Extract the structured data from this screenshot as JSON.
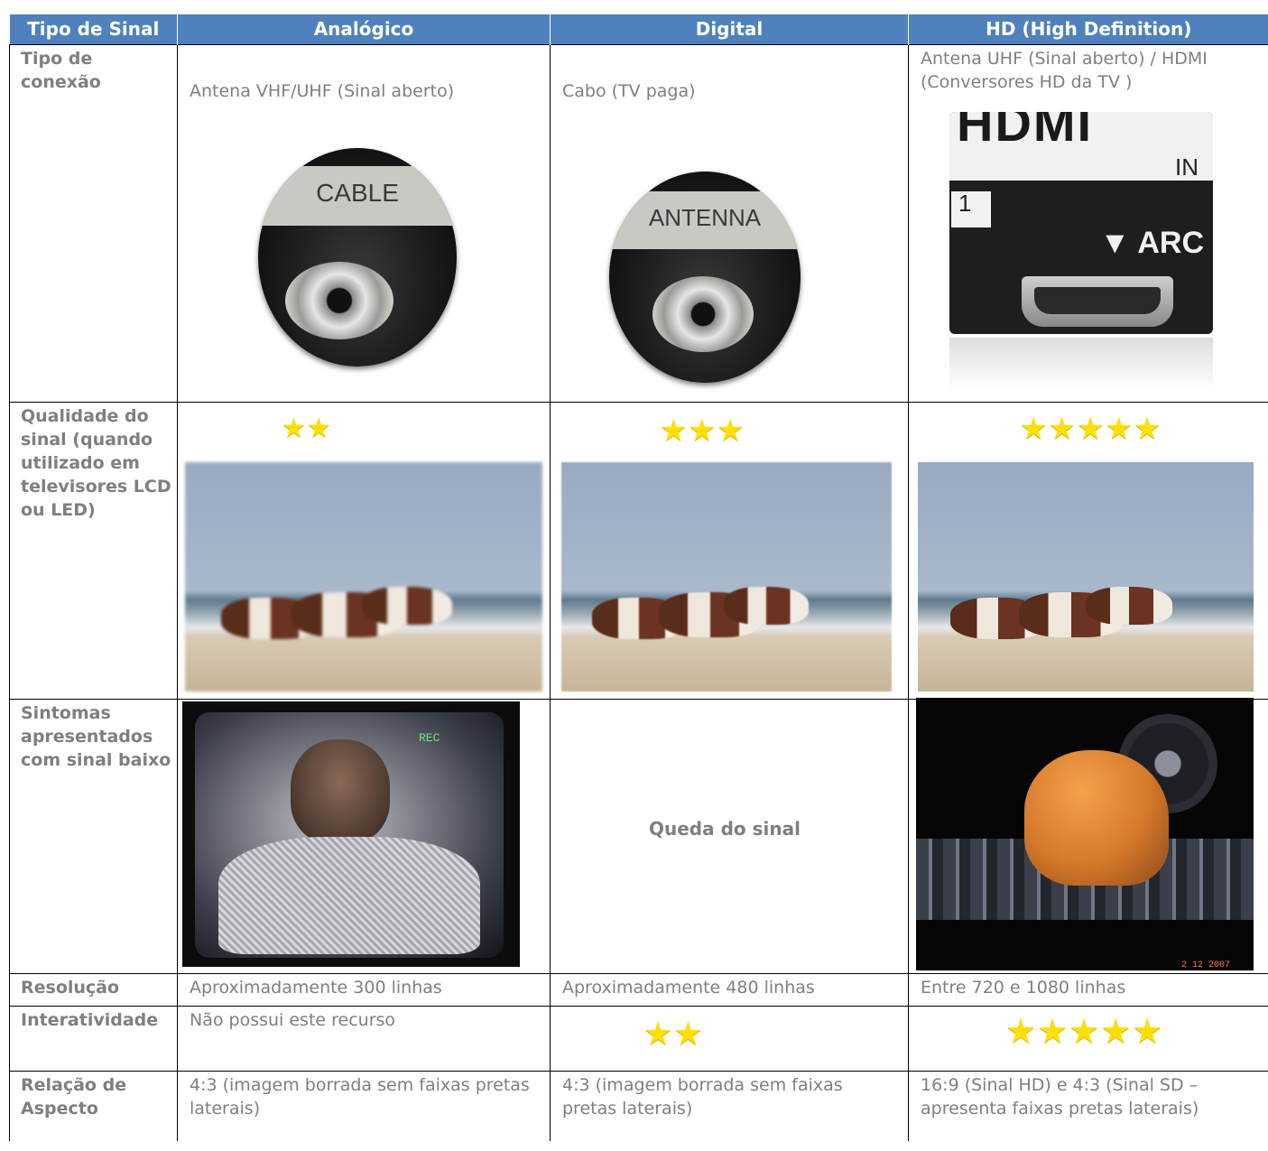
{
  "header": {
    "col0": "Tipo de Sinal",
    "col1": "Analógico",
    "col2": "Digital",
    "col3": "HD (High Definition)"
  },
  "rows": {
    "conexao": {
      "label": "Tipo de conexão",
      "analogico": "Antena VHF/UHF (Sinal aberto)",
      "digital": "Cabo (TV paga)",
      "hd": "Antena UHF (Sinal aberto) / HDMI (Conversores HD da TV )",
      "img_analogico_text": "CABLE",
      "img_digital_text": "ANTENNA",
      "img_hd_word": "HDMI",
      "img_hd_in": "IN",
      "img_hd_num": "1",
      "img_hd_arc": "▼ ARC"
    },
    "qualidade": {
      "label": "Qualidade do sinal (quando utilizado em televisores LCD ou LED)",
      "analogico_stars": "★★",
      "digital_stars": "★★★",
      "hd_stars": "★★★★★",
      "rating": {
        "analogico": 2,
        "digital": 3,
        "hd": 5
      }
    },
    "sintomas": {
      "label": "Sintomas apresentados com sinal baixo",
      "digital": "Queda do sinal",
      "img_analogico_text": "REC",
      "img_hd_date": "2 12 2007"
    },
    "resolucao": {
      "label": "Resolução",
      "analogico": "Aproximadamente 300 linhas",
      "digital": "Aproximadamente 480 linhas",
      "hd": "Entre 720 e 1080 linhas"
    },
    "interatividade": {
      "label": "Interatividade",
      "analogico": "Não possui este recurso",
      "digital_stars": "★★",
      "hd_stars": "★★★★★",
      "rating": {
        "digital": 2,
        "hd": 5
      }
    },
    "aspecto": {
      "label": "Relação de Aspecto",
      "analogico": "4:3 (imagem borrada sem faixas pretas laterais)",
      "digital": "4:3 (imagem borrada sem faixas pretas laterais)",
      "hd": "16:9 (Sinal HD) e 4:3 (Sinal SD – apresenta faixas pretas laterais)"
    }
  },
  "colors": {
    "header_bg": "#4f81bd",
    "header_text": "#ffffff",
    "body_text": "#7f7f7f",
    "star": "#ffe000"
  }
}
